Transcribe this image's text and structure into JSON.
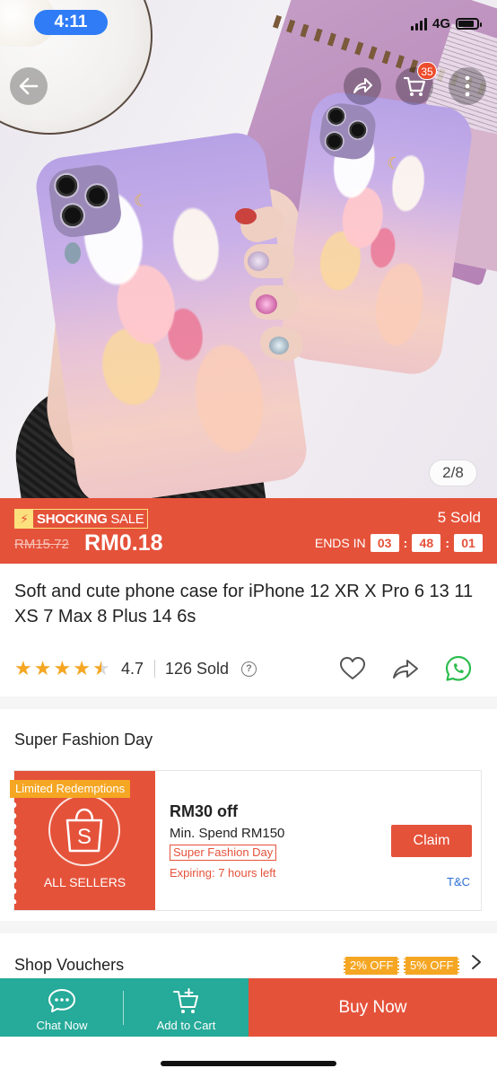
{
  "status_bar": {
    "time": "4:11",
    "network": "4G"
  },
  "header": {
    "cart_count": "35",
    "image_counter": "2/8"
  },
  "flash_sale": {
    "badge_icon": "lightning-icon",
    "title_bold": "SHOCKING",
    "title_rest": "SALE",
    "original_price": "RM15.72",
    "price": "RM0.18",
    "sold": "5 Sold",
    "ends_label": "ENDS IN",
    "timer": [
      "03",
      "48",
      "01"
    ]
  },
  "product": {
    "title": "Soft and cute phone case for iPhone 12 XR X Pro 6 13 11 XS 7 Max 8 Plus 14 6s",
    "rating": "4.7",
    "rating_stars": 4.5,
    "sold": "126 Sold",
    "help": "?"
  },
  "fashion_day": {
    "section_title": "Super Fashion Day",
    "voucher": {
      "limited": "Limited Redemptions",
      "sellers": "ALL SELLERS",
      "logo_letter": "S",
      "discount": "RM30 off",
      "min_spend": "Min. Spend RM150",
      "tag": "Super Fashion Day",
      "expiry": "Expiring: 7 hours left",
      "claim": "Claim",
      "tc": "T&C"
    }
  },
  "shop_vouchers": {
    "title": "Shop Vouchers",
    "tags": [
      "2% OFF",
      "5% OFF"
    ]
  },
  "bottom_bar": {
    "chat": "Chat Now",
    "add_to_cart": "Add to Cart",
    "buy_now": "Buy Now"
  },
  "colors": {
    "brand": "#e5523a",
    "teal": "#26aa99",
    "star": "#f5a623",
    "status_pill": "#2f7cf6"
  }
}
